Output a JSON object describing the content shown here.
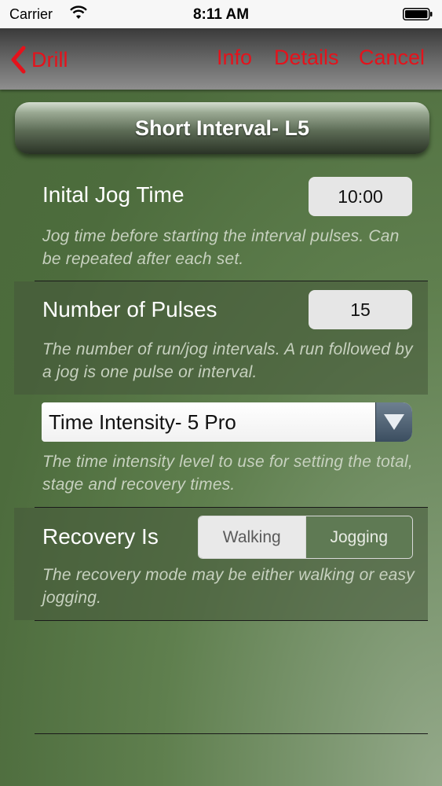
{
  "status_bar": {
    "carrier": "Carrier",
    "time": "8:11 AM"
  },
  "nav": {
    "back_label": "Drill",
    "info_label": "Info",
    "details_label": "Details",
    "cancel_label": "Cancel"
  },
  "title": "Short Interval- L5",
  "rows": {
    "jog_time": {
      "title": "Inital Jog Time",
      "value": "10:00",
      "description": "Jog time before starting the interval pulses. Can be repeated after each set."
    },
    "pulses": {
      "title": "Number of Pulses",
      "value": "15",
      "description": "The number of run/jog intervals. A run followed by a jog is one pulse or interval."
    },
    "intensity": {
      "selected": "Time Intensity- 5 Pro",
      "description": "The time intensity level to use for setting the total, stage and recovery times."
    },
    "recovery": {
      "title": "Recovery Is",
      "options": [
        "Walking",
        "Jogging"
      ],
      "selected": "Walking",
      "description": "The recovery mode may be either walking or easy jogging."
    }
  },
  "colors": {
    "accent_red": "#e5121b",
    "background_green": "#4f6e3f"
  }
}
